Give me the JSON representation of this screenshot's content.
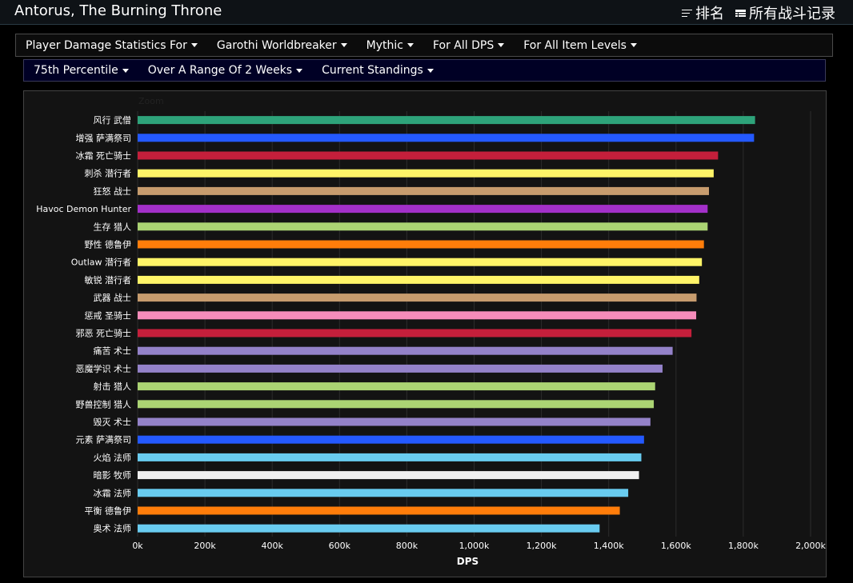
{
  "header": {
    "title": "Antorus, The Burning Throne",
    "links": [
      {
        "label": "排名",
        "icon": "list-lines-icon"
      },
      {
        "label": "所有战斗记录",
        "icon": "table-icon"
      }
    ]
  },
  "filters": {
    "row1": [
      "Player Damage Statistics For",
      "Garothi Worldbreaker",
      "Mythic",
      "For All DPS",
      "For All Item Levels"
    ],
    "row2": [
      "75th Percentile",
      "Over A Range Of 2 Weeks",
      "Current Standings"
    ]
  },
  "chart_data": {
    "type": "bar",
    "orientation": "horizontal",
    "zoom_label": "Zoom",
    "xlabel": "DPS",
    "ylabel": "",
    "xlim": [
      0,
      2000000
    ],
    "xticks": [
      "0k",
      "200k",
      "400k",
      "600k",
      "800k",
      "1,000k",
      "1,200k",
      "1,400k",
      "1,600k",
      "1,800k",
      "2,000k"
    ],
    "grid": true,
    "categories": [
      "风行 武僧",
      "增强 萨满祭司",
      "冰霜 死亡骑士",
      "刺杀 潜行者",
      "狂怒 战士",
      "Havoc Demon Hunter",
      "生存 猎人",
      "野性 德鲁伊",
      "Outlaw 潜行者",
      "敏锐 潜行者",
      "武器 战士",
      "惩戒 圣骑士",
      "邪恶 死亡骑士",
      "痛苦 术士",
      "恶魔学识 术士",
      "射击 猎人",
      "野兽控制 猎人",
      "毁灭 术士",
      "元素 萨满祭司",
      "火焰 法师",
      "暗影 牧师",
      "冰霜 法师",
      "平衡 德鲁伊",
      "奥术 法师"
    ],
    "values": [
      1835000,
      1832000,
      1725000,
      1712000,
      1698000,
      1694000,
      1694000,
      1683000,
      1677000,
      1669000,
      1661000,
      1660000,
      1646000,
      1590000,
      1560000,
      1538000,
      1534000,
      1524000,
      1505000,
      1497000,
      1490000,
      1458000,
      1433000,
      1373000
    ],
    "colors": [
      "#2ea37a",
      "#2459ff",
      "#c41f3b",
      "#fff468",
      "#c79c6e",
      "#a330c9",
      "#abd473",
      "#ff7d0a",
      "#fff468",
      "#fff468",
      "#c79c6e",
      "#f58cba",
      "#c41f3b",
      "#9482c9",
      "#9482c9",
      "#abd473",
      "#abd473",
      "#9482c9",
      "#2459ff",
      "#69ccf0",
      "#f0f0f0",
      "#69ccf0",
      "#ff7d0a",
      "#69ccf0"
    ]
  }
}
